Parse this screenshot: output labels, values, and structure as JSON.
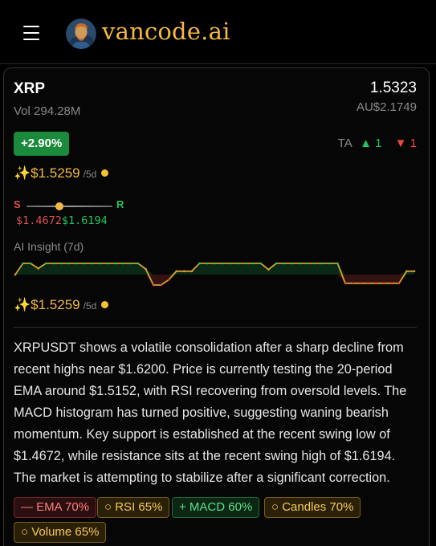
{
  "header": {
    "brand": "vancode.ai",
    "menu_icon": "hamburger-menu-icon",
    "logo_icon": "van-gogh-portrait-logo"
  },
  "asset": {
    "symbol": "XRP",
    "price": "1.5323",
    "volume": "Vol 294.28M",
    "aud_price": "AU$2.1749",
    "change": "+2.90%"
  },
  "ta": {
    "label": "TA",
    "up_arrow": "▲",
    "up_count": "1",
    "down_arrow": "▼",
    "down_count": "1"
  },
  "target": {
    "sparkle": "✨",
    "value": "$1.5259",
    "period": "/5d"
  },
  "support_resistance": {
    "s_label": "S",
    "r_label": "R",
    "support": "$1.4672",
    "resistance": "$1.6194",
    "position": 0.38
  },
  "insight": {
    "label": "AI Insight (7d)",
    "levels": [
      0,
      1,
      1,
      0.55,
      1,
      1,
      1,
      1,
      1,
      1,
      1,
      1,
      1,
      1,
      1,
      1,
      1,
      0.5,
      -0.3,
      -0.3,
      -0.15,
      0.3,
      0.3,
      0.3,
      1,
      1,
      1,
      1,
      1,
      1,
      1,
      1,
      1,
      0.45,
      1,
      1,
      1,
      1,
      1,
      1,
      1,
      1,
      1,
      -0.25,
      -0.25,
      -0.25,
      -0.25,
      -0.25,
      -0.25,
      -0.25,
      -0.25,
      0.3,
      0.3
    ],
    "colors": {
      "bull": "#22c55e",
      "bear": "#ef4444",
      "line": "#d4a32e"
    }
  },
  "summary": "XRPUSDT shows a volatile consolidation after a sharp decline from recent highs near $1.6200. Price is currently testing the 20-period EMA around $1.5152, with RSI recovering from oversold levels. The MACD histogram has turned positive, suggesting waning bearish momentum. Key support is established at the recent swing low of $1.4672, while resistance sits at the recent swing high of $1.6194. The market is attempting to stabilize after a significant correction.",
  "tags": [
    {
      "label": "— EMA 70%",
      "tone": "red"
    },
    {
      "label": "○ RSI 65%",
      "tone": "yellow"
    },
    {
      "label": "+ MACD 60%",
      "tone": "green"
    },
    {
      "label": "○ Candles 70%",
      "tone": "yellow"
    },
    {
      "label": "○ Volume 65%",
      "tone": "yellow"
    }
  ]
}
